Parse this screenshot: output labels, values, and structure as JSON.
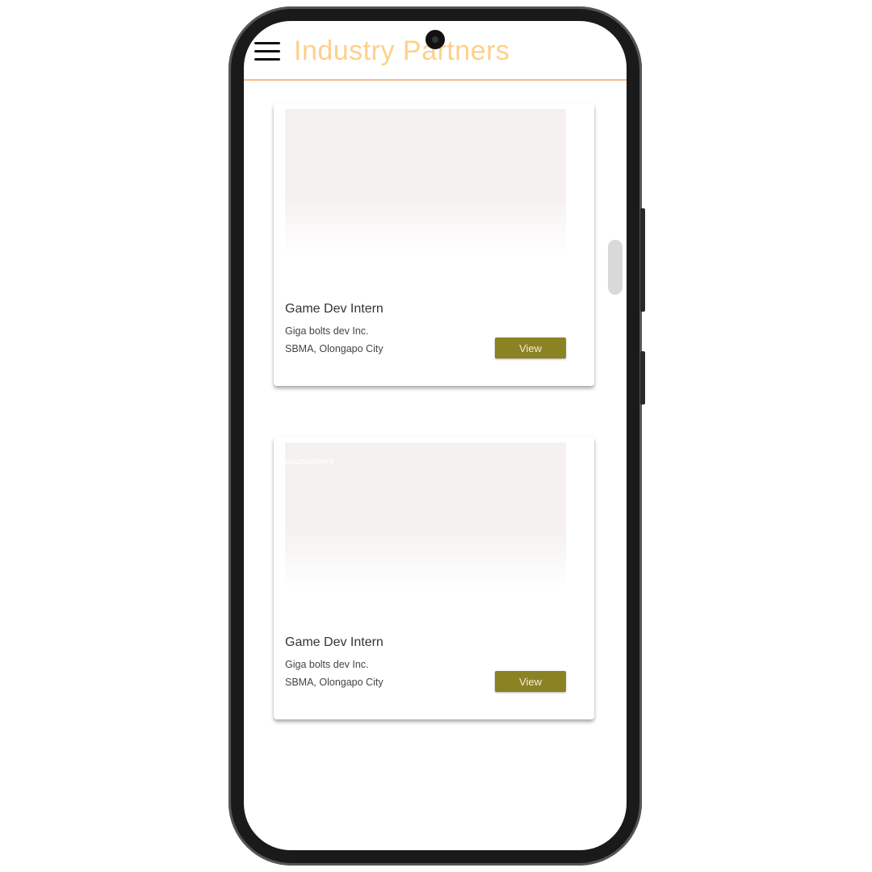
{
  "header": {
    "title": "Industry Partners"
  },
  "cards": [
    {
      "job": "Game Dev Intern",
      "company": "Giga bolts dev Inc.",
      "location": "SBMA, Olongapo City",
      "button": "View",
      "image_caption": ""
    },
    {
      "job": "Game Dev Intern",
      "company": "Giga bolts dev Inc.",
      "location": "SBMA, Olongapo City",
      "button": "View",
      "image_caption": "nouncement"
    }
  ],
  "colors": {
    "title": "#fdd08a",
    "accent_line": "#f8b98a",
    "button": "#8b8224"
  }
}
